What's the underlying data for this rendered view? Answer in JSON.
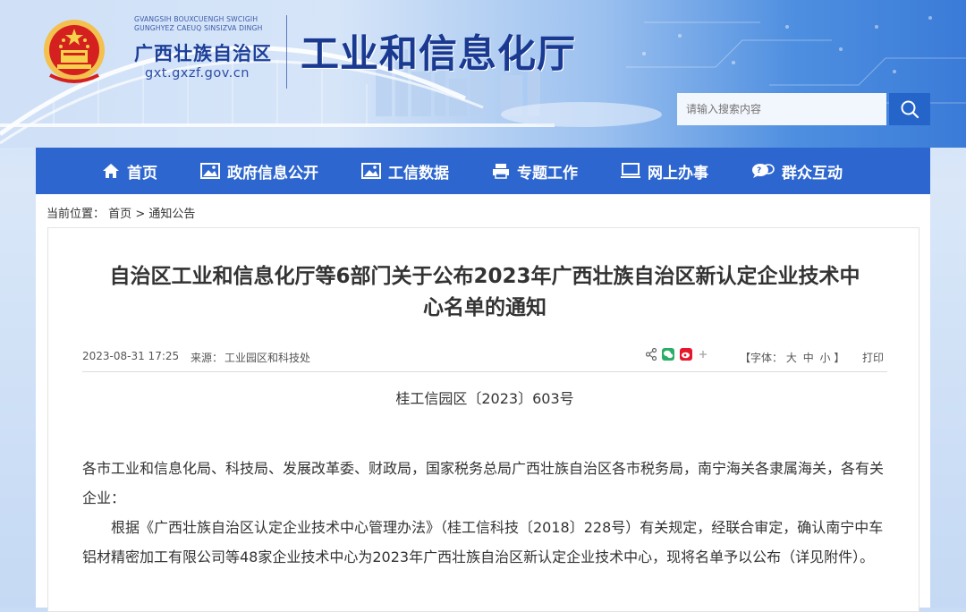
{
  "header": {
    "org_en": "GVANGSIH BOUXCUENGH SWCIGIH GUNGHYEZ CAEUQ SINSIZVA DINGH",
    "org_cn": "广西壮族自治区",
    "url": "gxt.gxzf.gov.cn",
    "dept_title": "工业和信息化厅"
  },
  "search": {
    "placeholder": "请输入搜索内容"
  },
  "nav": [
    {
      "label": "首页",
      "icon": "home-icon"
    },
    {
      "label": "政府信息公开",
      "icon": "image-icon"
    },
    {
      "label": "工信数据",
      "icon": "image-icon"
    },
    {
      "label": "专题工作",
      "icon": "printer-icon"
    },
    {
      "label": "网上办事",
      "icon": "monitor-icon"
    },
    {
      "label": "群众互动",
      "icon": "chat-icon"
    }
  ],
  "breadcrumb": {
    "label": "当前位置：",
    "home": "首页",
    "sep": " > ",
    "current": "通知公告"
  },
  "article": {
    "title_line1": "自治区工业和信息化厅等6部门关于公布2023年广西壮族自治区新认定企业技术中",
    "title_line2": "心名单的通知",
    "date": "2023-08-31 17:25",
    "source_label": "来源：",
    "source": "工业园区和科技处",
    "font_label": "【字体：",
    "font_large": "大",
    "font_medium": "中",
    "font_small": "小",
    "font_close": "】",
    "print": "打印",
    "doc_number": "桂工信园区〔2023〕603号",
    "para1": "各市工业和信息化局、科技局、发展改革委、财政局，国家税务总局广西壮族自治区各市税务局，南宁海关各隶属海关，各有关企业：",
    "para2": "根据《广西壮族自治区认定企业技术中心管理办法》（桂工信科技〔2018〕228号）有关规定，经联合审定，确认南宁中车铝材精密加工有限公司等48家企业技术中心为2023年广西壮族自治区新认定企业技术中心，现将名单予以公布（详见附件）。"
  },
  "colors": {
    "nav_bg": "#2d66cf",
    "title_blue": "#1a3a92",
    "search_btn": "#2564c8"
  }
}
